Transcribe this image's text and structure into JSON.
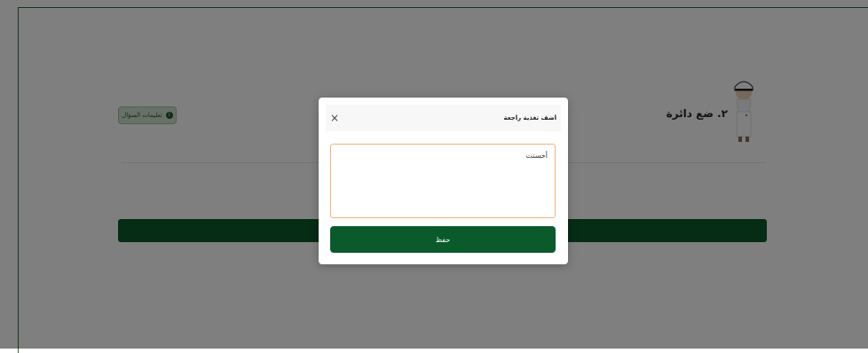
{
  "question": {
    "title": "٢. ضع دائرة"
  },
  "settings_badge": {
    "label": "تعليمات السؤال",
    "icon": "info-icon"
  },
  "modal": {
    "title": "اضف تغذية راجعة",
    "close_label": "×",
    "textarea_value": "أحسنت",
    "save_label": "حفظ"
  },
  "colors": {
    "primary": "#0b5a2b",
    "input_border": "#f2b37a",
    "overlay": "rgba(0,0,0,0.5)"
  }
}
